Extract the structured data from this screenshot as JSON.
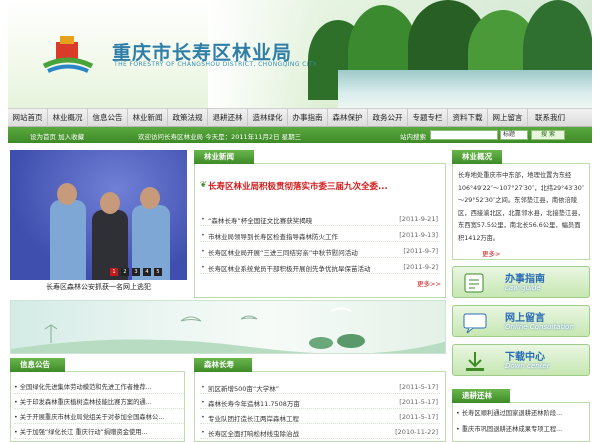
{
  "header": {
    "site_title": "重庆市长寿区林业局",
    "site_subtitle": "THE FORESTRY OF CHANGSHOU DISTRICT, CHONGQING CITY"
  },
  "nav": {
    "items": [
      "网站首页",
      "林业概况",
      "信息公告",
      "林业新闻",
      "政策法规",
      "退耕还林",
      "造林绿化",
      "办事指南",
      "森林保护",
      "政务公开",
      "专题专栏",
      "资料下载",
      "网上留言",
      "联系我们"
    ]
  },
  "infobar": {
    "left_text": "设为首页  加入收藏",
    "welcome_date": "欢迎访问长寿区林业局  今天是：2011年11月2日  星期三",
    "search_label": "站内搜索",
    "search_placeholder": "",
    "search_select": "标题",
    "search_button": "搜 索"
  },
  "photo": {
    "caption": "长寿区森林公安抓获一名网上逃犯",
    "dots": [
      "1",
      "2",
      "3",
      "4",
      "5"
    ],
    "active_dot": 1
  },
  "news": {
    "title": "林业新闻",
    "headline": "长寿区林业局积极贯彻落实市委三届九次全委...",
    "items": [
      {
        "title": "“森林长寿”杯全国征文比赛获奖揭晓",
        "date": "[2011-9-21]"
      },
      {
        "title": "市林业局领导到长寿区检查指导森林防火工作",
        "date": "[2011-9-13]"
      },
      {
        "title": "长寿区林业局开展“三进三同结穷亲”中秋节慰问活动",
        "date": "[2011-9-7]"
      },
      {
        "title": "长寿区林业系统党员干部积极开展创先争优抗旱保苗活动",
        "date": "[2011-9-2]"
      }
    ],
    "more": "更多>>"
  },
  "overview": {
    "title": "林业概况",
    "text": "长寿地处重庆市中东部，地理位置为东经106°49′22″～107°27′30″，北纬29°43′30″～29°52′30″之间。东邻垫江县，南依涪陵区，西接渝北区，北靠邻水县，北接垫江县，东西宽57.5公里，南北长56.6公里，幅员面积1412万亩。",
    "more": "更多>"
  },
  "quick_links": [
    {
      "title": "办事指南",
      "subtitle": "Law guide",
      "icon": "law-guide-icon"
    },
    {
      "title": "网上留言",
      "subtitle": "Online Consultation",
      "icon": "online-consultation-icon"
    },
    {
      "title": "下载中心",
      "subtitle": "Down center",
      "icon": "download-center-icon"
    }
  ],
  "notices": {
    "title": "信息公告",
    "items": [
      "全国绿化先进集体劳动模范和先进工作者推荐...",
      "关于印发森林重庆植树造林技能比赛方案的通...",
      "关于开展重庆市林业局党组关于对参加全国森林公...",
      "关于加强“绿化长江 重庆行动”捐赠资金使用..."
    ]
  },
  "forest": {
    "title": "森林长寿",
    "items": [
      {
        "title": "凯区新增500亩“大学林”",
        "date": "[2011-5-17]"
      },
      {
        "title": "森林长寿今年造林11.7508万亩",
        "date": "[2011-5-17]"
      },
      {
        "title": "专业队团打造长江两岸森林工程",
        "date": "[2011-5-17]"
      },
      {
        "title": "长寿区全面打响松材线虫除治战",
        "date": "[2010-11-22]"
      }
    ]
  },
  "tuigeng": {
    "title": "退耕还林",
    "items": [
      "长寿区顺利通过国家退耕还林阶段...",
      "重庆市巩固退耕还林成果专项工程..."
    ]
  },
  "colors": {
    "brand_green": "#3e8a28",
    "title_blue": "#2f7ea8",
    "headline_red": "#d11b1b"
  }
}
